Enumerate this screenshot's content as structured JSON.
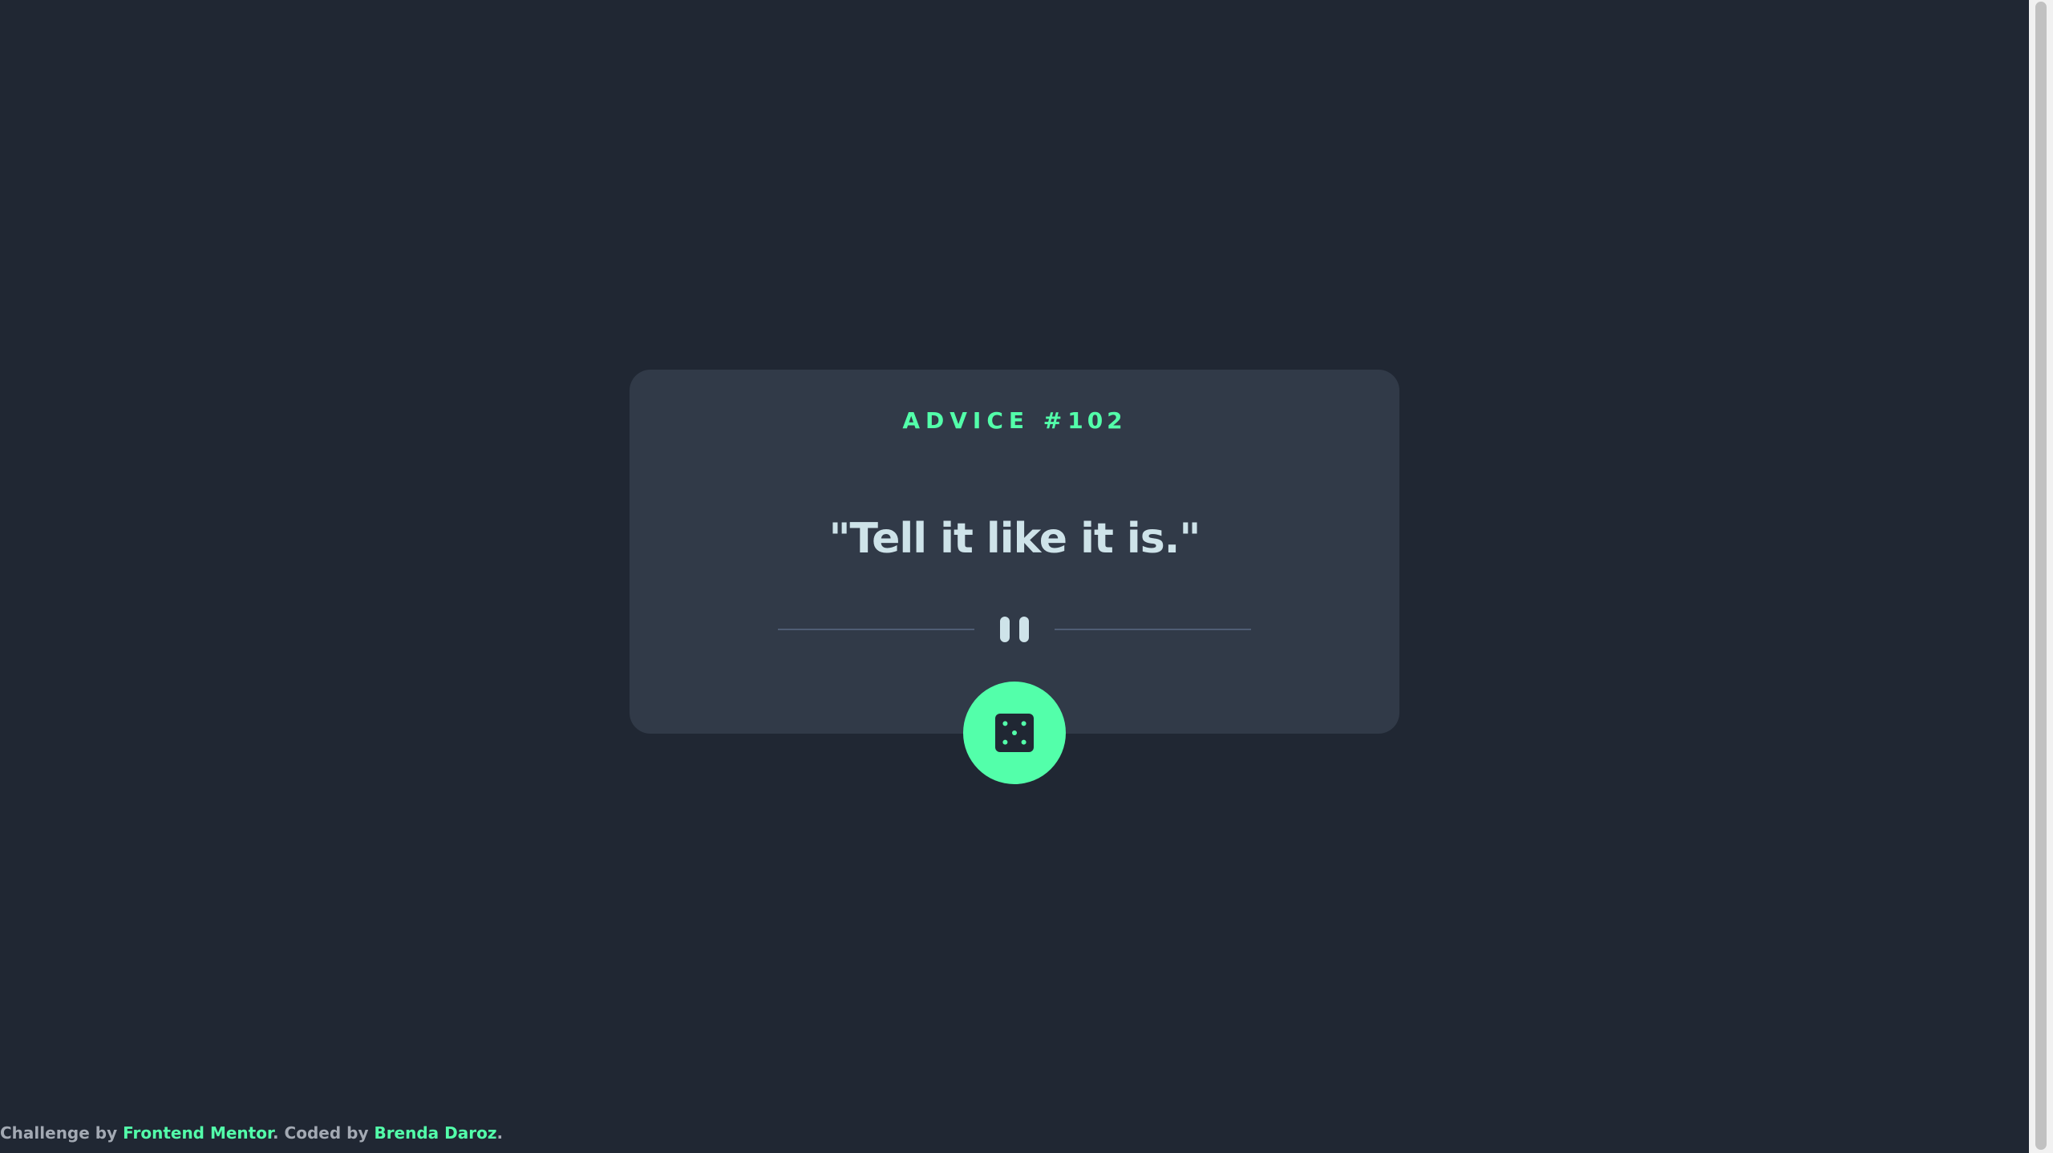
{
  "card": {
    "advice_label": "ADVICE #",
    "advice_number": "102",
    "quote": "\"Tell it like it is.\""
  },
  "actions": {
    "dice_icon": "dice-icon"
  },
  "footer": {
    "prefix": "Challenge by ",
    "challenge_link": "Frontend Mentor",
    "middle": ". Coded by ",
    "author_link": "Brenda Daroz",
    "suffix": "."
  },
  "colors": {
    "background": "#202733",
    "card": "#313a48",
    "accent": "#53ffaa",
    "quote_text": "#cee3e9",
    "divider": "#4f5d74"
  }
}
